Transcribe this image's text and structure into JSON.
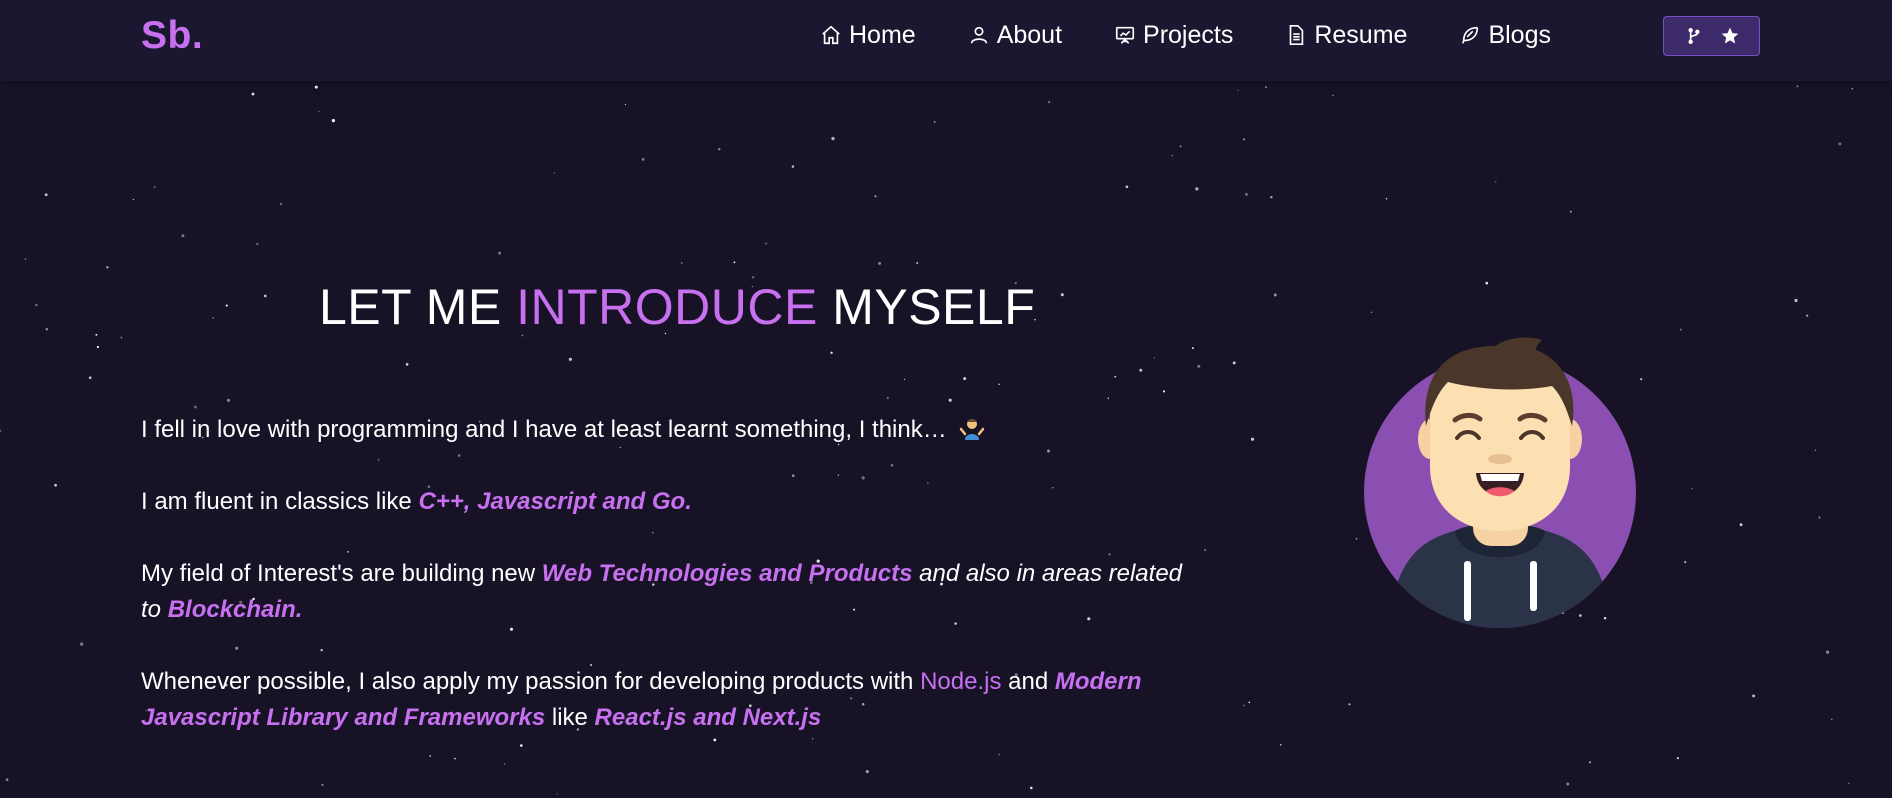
{
  "brand": {
    "logo": "Sb."
  },
  "nav": {
    "items": [
      {
        "label": "Home",
        "icon": "home-icon"
      },
      {
        "label": "About",
        "icon": "user-icon"
      },
      {
        "label": "Projects",
        "icon": "presentation-icon"
      },
      {
        "label": "Resume",
        "icon": "document-icon"
      },
      {
        "label": "Blogs",
        "icon": "feather-icon"
      }
    ],
    "fork_button": {
      "icons": [
        "git-fork-icon",
        "star-icon"
      ]
    }
  },
  "hero": {
    "heading": {
      "part1": "LET ME ",
      "accent": "INTRODUCE",
      "part2": " MYSELF"
    },
    "paragraphs": {
      "p1": {
        "text": "I fell in love with programming and I have at least learnt something, I think… ",
        "emoji": "person-shrugging-icon"
      },
      "p2": {
        "text": "I am fluent in classics like ",
        "highlight": "C++, Javascript and Go."
      },
      "p3": {
        "text1": "My field of Interest's are building new  ",
        "highlight1": "Web Technologies and Products",
        "text2": " and also in areas related to ",
        "highlight2": "Blockchain."
      },
      "p4": {
        "text1": "Whenever possible, I also apply my passion for developing products with ",
        "highlight1": "Node.js",
        "text2": " and ",
        "highlight2": "Modern Javascript Library and Frameworks",
        "text3": "  like ",
        "highlight3": "React.js and Next.js"
      }
    }
  },
  "colors": {
    "background": "#171226",
    "navbar": "#1b1730",
    "accent": "#c770f0",
    "avatar_circle": "#8a4fb0"
  }
}
